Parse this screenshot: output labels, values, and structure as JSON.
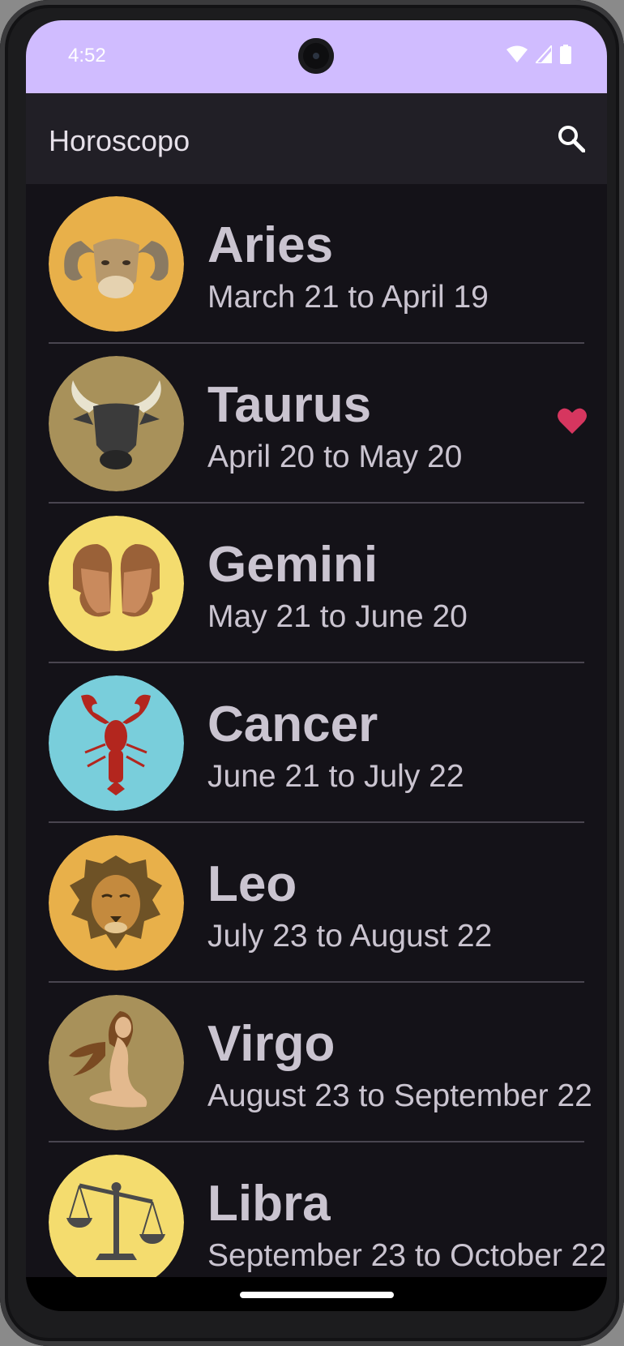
{
  "status_bar": {
    "time": "4:52",
    "icons": [
      "wifi-icon",
      "signal-icon",
      "battery-icon"
    ],
    "background": "#d0bcff"
  },
  "app_bar": {
    "title": "Horoscopo",
    "action_icon": "search-icon"
  },
  "signs": [
    {
      "name": "Aries",
      "dates": "March 21 to April 19",
      "favorite": false,
      "icon": "ram-icon",
      "bg": "#e8b04a"
    },
    {
      "name": "Taurus",
      "dates": "April 20 to May 20",
      "favorite": true,
      "icon": "bull-icon",
      "bg": "#a8915a"
    },
    {
      "name": "Gemini",
      "dates": "May 21 to June 20",
      "favorite": false,
      "icon": "twins-icon",
      "bg": "#f4dc6e"
    },
    {
      "name": "Cancer",
      "dates": "June 21 to July 22",
      "favorite": false,
      "icon": "lobster-icon",
      "bg": "#79cedb"
    },
    {
      "name": "Leo",
      "dates": "July 23 to August 22",
      "favorite": false,
      "icon": "lion-icon",
      "bg": "#e8b04a"
    },
    {
      "name": "Virgo",
      "dates": "August 23 to September 22",
      "favorite": false,
      "icon": "maiden-icon",
      "bg": "#a8915a"
    },
    {
      "name": "Libra",
      "dates": "September 23 to October 22",
      "favorite": false,
      "icon": "scales-icon",
      "bg": "#f4dc6e"
    }
  ],
  "colors": {
    "background": "#141218",
    "app_bar": "#211f26",
    "text": "#cac4d0",
    "favorite": "#d6365f"
  }
}
